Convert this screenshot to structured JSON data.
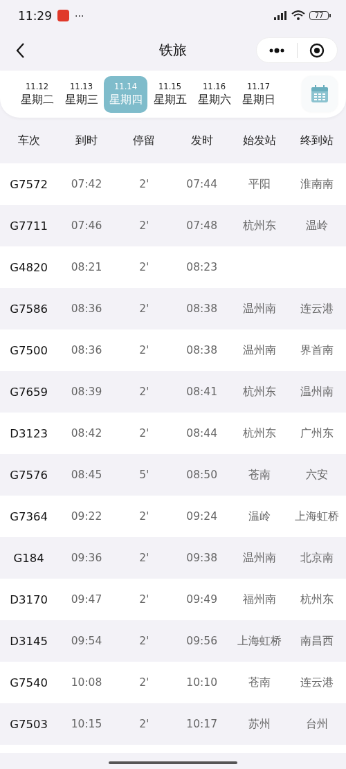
{
  "status_bar": {
    "time": "11:29",
    "more": "···",
    "battery": "77"
  },
  "nav": {
    "title": "铁旅"
  },
  "dates": [
    {
      "date": "11.12",
      "weekday": "星期二",
      "selected": false
    },
    {
      "date": "11.13",
      "weekday": "星期三",
      "selected": false
    },
    {
      "date": "11.14",
      "weekday": "星期四",
      "selected": true
    },
    {
      "date": "11.15",
      "weekday": "星期五",
      "selected": false
    },
    {
      "date": "11.16",
      "weekday": "星期六",
      "selected": false
    },
    {
      "date": "11.17",
      "weekday": "星期日",
      "selected": false
    }
  ],
  "table": {
    "columns": [
      "车次",
      "到时",
      "停留",
      "发时",
      "始发站",
      "终到站"
    ],
    "rows": [
      [
        "G7572",
        "07:42",
        "2'",
        "07:44",
        "平阳",
        "淮南南"
      ],
      [
        "G7711",
        "07:46",
        "2'",
        "07:48",
        "杭州东",
        "温岭"
      ],
      [
        "G4820",
        "08:21",
        "2'",
        "08:23",
        "",
        ""
      ],
      [
        "G7586",
        "08:36",
        "2'",
        "08:38",
        "温州南",
        "连云港"
      ],
      [
        "G7500",
        "08:36",
        "2'",
        "08:38",
        "温州南",
        "界首南"
      ],
      [
        "G7659",
        "08:39",
        "2'",
        "08:41",
        "杭州东",
        "温州南"
      ],
      [
        "D3123",
        "08:42",
        "2'",
        "08:44",
        "杭州东",
        "广州东"
      ],
      [
        "G7576",
        "08:45",
        "5'",
        "08:50",
        "苍南",
        "六安"
      ],
      [
        "G7364",
        "09:22",
        "2'",
        "09:24",
        "温岭",
        "上海虹桥"
      ],
      [
        "G184",
        "09:36",
        "2'",
        "09:38",
        "温州南",
        "北京南"
      ],
      [
        "D3170",
        "09:47",
        "2'",
        "09:49",
        "福州南",
        "杭州东"
      ],
      [
        "D3145",
        "09:54",
        "2'",
        "09:56",
        "上海虹桥",
        "南昌西"
      ],
      [
        "G7540",
        "10:08",
        "2'",
        "10:10",
        "苍南",
        "连云港"
      ],
      [
        "G7503",
        "10:15",
        "2'",
        "10:17",
        "苏州",
        "台州"
      ]
    ]
  }
}
